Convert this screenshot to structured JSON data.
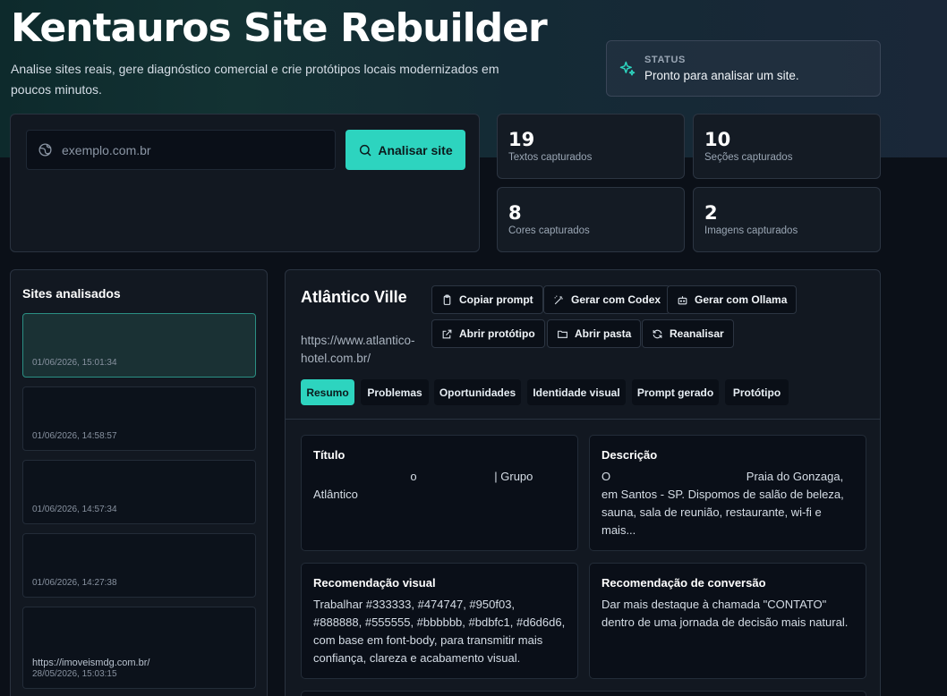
{
  "header": {
    "title": "Kentauros Site Rebuilder",
    "subtitle": "Analise sites reais, gere diagnóstico comercial e crie protótipos locais modernizados em poucos minutos."
  },
  "status": {
    "label": "STATUS",
    "text": "Pronto para analisar um site."
  },
  "search": {
    "placeholder": "exemplo.com.br",
    "button_label": "Analisar site"
  },
  "stats": [
    {
      "value": "19",
      "caption": "Textos capturados"
    },
    {
      "value": "10",
      "caption": "Seções capturados"
    },
    {
      "value": "8",
      "caption": "Cores capturados"
    },
    {
      "value": "2",
      "caption": "Imagens capturados"
    }
  ],
  "sites": {
    "heading": "Sites analisados",
    "items": [
      {
        "url": "",
        "date": "01/06/2026, 15:01:34"
      },
      {
        "url": "",
        "date": "01/06/2026, 14:58:57"
      },
      {
        "url": "",
        "date": "01/06/2026, 14:57:34"
      },
      {
        "url": "",
        "date": "01/06/2026, 14:27:38"
      },
      {
        "url": "https://imoveismdg.com.br/",
        "date": "28/05/2026, 15:03:15"
      }
    ]
  },
  "detail": {
    "name": "Atlântico Ville",
    "url": "https://www.atlantico-hotel.com.br/",
    "actions": {
      "copy_prompt": "Copiar prompt",
      "codex": "Gerar com Codex",
      "ollama": "Gerar com Ollama",
      "open_prototype": "Abrir protótipo",
      "open_folder": "Abrir pasta",
      "reanalyze": "Reanalisar"
    },
    "tabs": [
      "Resumo",
      "Problemas",
      "Oportunidades",
      "Identidade visual",
      "Prompt gerado",
      "Protótipo"
    ],
    "cards": {
      "title_heading": "Título",
      "title_text": "                              o                        | Grupo Atlântico",
      "desc_heading": "Descrição",
      "desc_text": "O                                          Praia do Gonzaga, em Santos - SP. Dispomos de salão de beleza, sauna, sala de reunião, restaurante, wi-fi e mais...",
      "visual_heading": "Recomendação visual",
      "visual_text": "Trabalhar #333333, #474747, #950f03, #888888, #555555, #bbbbbb, #bdbfc1, #d6d6d6, com base em font-body, para transmitir mais confiança, clareza e acabamento visual.",
      "conv_heading": "Recomendação de conversão",
      "conv_text": "Dar mais destaque à chamada \"CONTATO\" dentro de uma jornada de decisão mais natural."
    }
  },
  "colors": {
    "accent": "#2dd4bf",
    "background": "#0b1018",
    "panel": "#121821"
  }
}
